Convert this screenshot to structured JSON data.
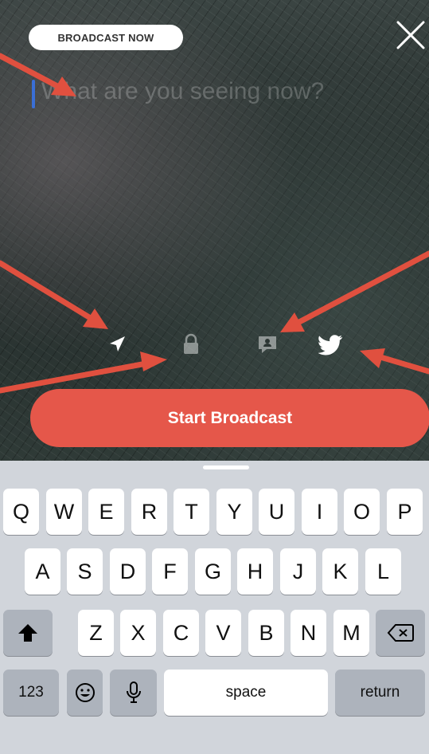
{
  "header": {
    "badge": "BROADCAST NOW"
  },
  "compose": {
    "placeholder": "What are you seeing now?"
  },
  "options": [
    {
      "icon": "location-icon"
    },
    {
      "icon": "lock-icon"
    },
    {
      "icon": "chat-icon"
    },
    {
      "icon": "twitter-icon"
    }
  ],
  "start_button": {
    "label": "Start Broadcast"
  },
  "colors": {
    "accent": "#e5574a",
    "arrow": "#e0503f",
    "caret": "#3a6fd6"
  },
  "keyboard": {
    "row1": [
      "Q",
      "W",
      "E",
      "R",
      "T",
      "Y",
      "U",
      "I",
      "O",
      "P"
    ],
    "row2": [
      "A",
      "S",
      "D",
      "F",
      "G",
      "H",
      "J",
      "K",
      "L"
    ],
    "row3": [
      "Z",
      "X",
      "C",
      "V",
      "B",
      "N",
      "M"
    ],
    "bottom": {
      "numbers": "123",
      "space": "space",
      "return": "return"
    }
  }
}
